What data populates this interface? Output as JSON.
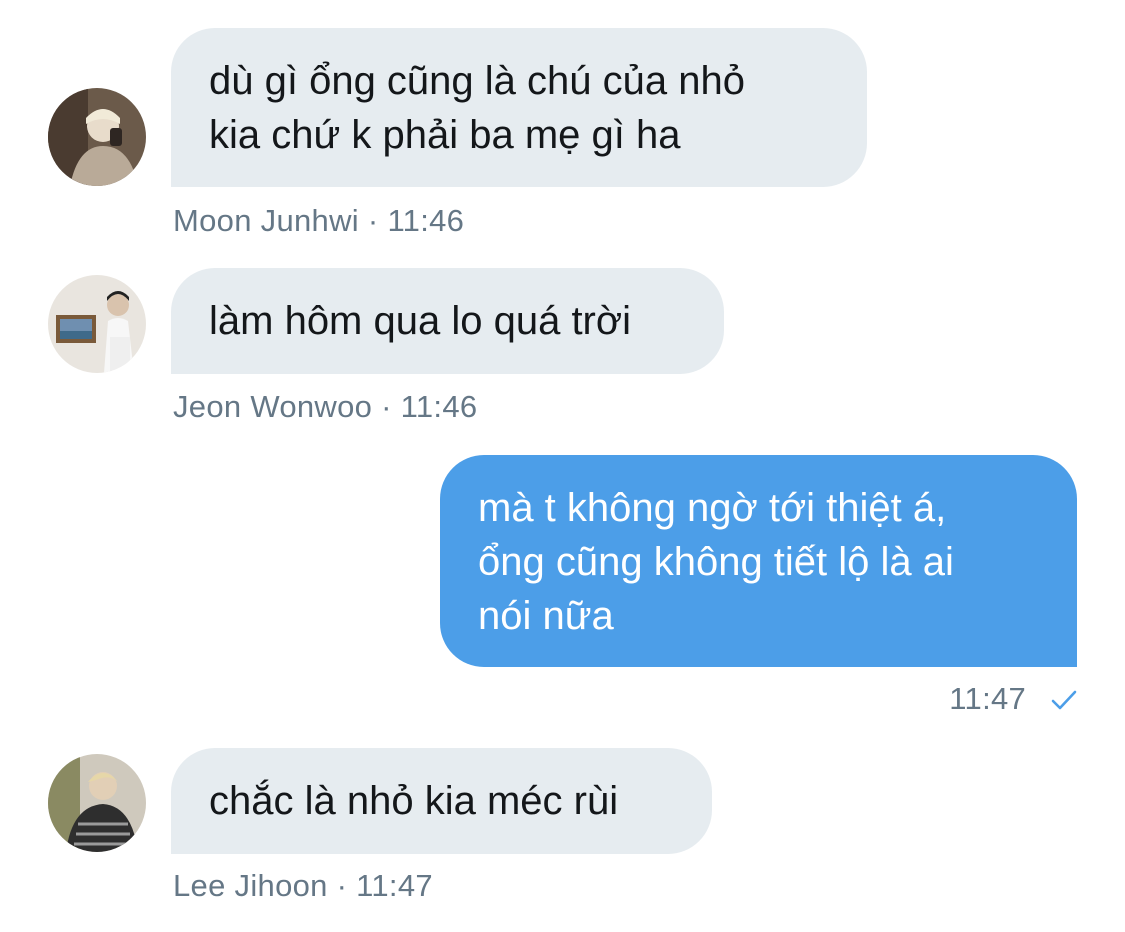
{
  "colors": {
    "incoming_bubble": "#e6ecf0",
    "outgoing_bubble": "#4c9ee8",
    "meta_text": "#657786",
    "read_check": "#4c9ee8"
  },
  "messages": [
    {
      "direction": "incoming",
      "avatar": "avatar-photo",
      "text": "dù gì ổng cũng là chú của nhỏ\nkia chứ k phải ba mẹ gì ha",
      "sender": "Moon Junhwi",
      "separator": "·",
      "time": "11:46"
    },
    {
      "direction": "incoming",
      "avatar": "avatar-photo",
      "text": "làm hôm qua lo quá trời",
      "sender": "Jeon Wonwoo",
      "separator": "·",
      "time": "11:46"
    },
    {
      "direction": "outgoing",
      "text": "mà t không ngờ tới thiệt á,\nổng cũng không tiết lộ là ai\nnói nữa",
      "time": "11:47",
      "status_icon": "checkmark-icon"
    },
    {
      "direction": "incoming",
      "avatar": "avatar-photo",
      "text": "chắc là nhỏ kia méc rùi",
      "sender": "Lee Jihoon",
      "separator": "·",
      "time": "11:47"
    }
  ]
}
